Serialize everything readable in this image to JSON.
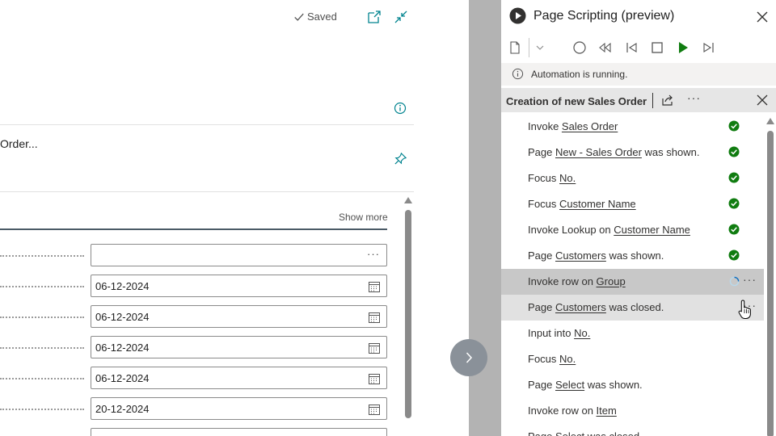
{
  "page": {
    "saved_label": "Saved",
    "order_text": "Order...",
    "show_more": "Show more",
    "fields": [
      {
        "value": "",
        "icon": "ellipsis-icon"
      },
      {
        "value": "06-12-2024",
        "icon": "calendar-icon"
      },
      {
        "value": "06-12-2024",
        "icon": "calendar-icon"
      },
      {
        "value": "06-12-2024",
        "icon": "calendar-icon"
      },
      {
        "value": "06-12-2024",
        "icon": "calendar-icon"
      },
      {
        "value": "20-12-2024",
        "icon": "calendar-icon"
      }
    ],
    "more_dots": "···"
  },
  "pane": {
    "title": "Page Scripting (preview)",
    "banner": "Automation is running.",
    "recording_title": "Creation of new Sales Order",
    "more": "···",
    "steps": [
      {
        "pre": "Invoke ",
        "link": "Sales Order",
        "post": "",
        "status": "done"
      },
      {
        "pre": "Page ",
        "link": "New - Sales Order",
        "post": " was shown.",
        "status": "done"
      },
      {
        "pre": "Focus ",
        "link": "No.",
        "post": "",
        "status": "done"
      },
      {
        "pre": "Focus ",
        "link": "Customer Name",
        "post": "",
        "status": "done"
      },
      {
        "pre": "Invoke Lookup on ",
        "link": "Customer Name",
        "post": "",
        "status": "done"
      },
      {
        "pre": "Page ",
        "link": "Customers",
        "post": " was shown.",
        "status": "done"
      },
      {
        "pre": "Invoke row on ",
        "link": "Group",
        "post": "",
        "status": "running"
      },
      {
        "pre": "Page ",
        "link": "Customers",
        "post": " was closed.",
        "status": "hover"
      },
      {
        "pre": "Input into ",
        "link": "No.",
        "post": "",
        "status": "pending"
      },
      {
        "pre": "Focus ",
        "link": "No.",
        "post": "",
        "status": "pending"
      },
      {
        "pre": "Page ",
        "link": "Select",
        "post": " was shown.",
        "status": "pending"
      },
      {
        "pre": "Invoke row on ",
        "link": "Item",
        "post": "",
        "status": "pending"
      },
      {
        "pre": "Page ",
        "link": "Select",
        "post": " was closed.",
        "status": "pending"
      }
    ]
  },
  "colors": {
    "success": "#107c10",
    "accent": "#00838f"
  }
}
